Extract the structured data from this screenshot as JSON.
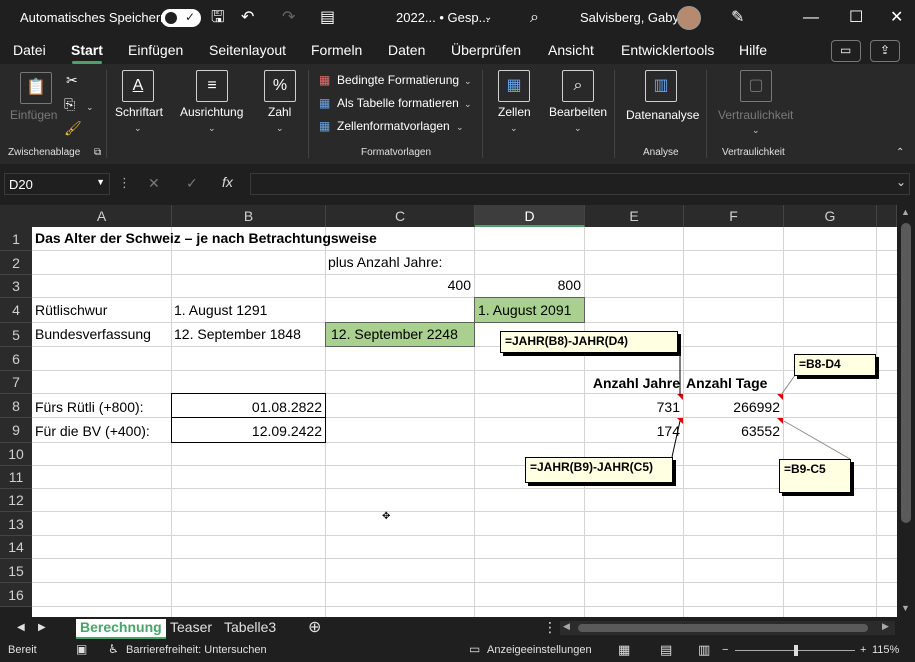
{
  "titlebar": {
    "autosave_label": "Automatisches Speichern",
    "doc_title": "2022... • Gesp...",
    "user_name": "Salvisberg, Gaby"
  },
  "menu": {
    "tabs": [
      "Datei",
      "Start",
      "Einfügen",
      "Seitenlayout",
      "Formeln",
      "Daten",
      "Überprüfen",
      "Ansicht",
      "Entwicklertools",
      "Hilfe"
    ],
    "active": "Start"
  },
  "ribbon": {
    "einfuegen": "Einfügen",
    "zwischenablage": "Zwischenablage",
    "schriftart": "Schriftart",
    "ausrichtung": "Ausrichtung",
    "zahl": "Zahl",
    "bedingte": "Bedingte Formatierung",
    "als_tabelle": "Als Tabelle formatieren",
    "zellenformat": "Zellenformatvorlagen",
    "formatvorlagen": "Formatvorlagen",
    "zellen": "Zellen",
    "bearbeiten": "Bearbeiten",
    "datenanalyse": "Datenanalyse",
    "analyse": "Analyse",
    "vertraulichkeit_btn": "Vertraulichkeit",
    "vertraulichkeit_group": "Vertraulichkeit"
  },
  "formula_bar": {
    "name_box": "D20",
    "fx": "fx",
    "formula": ""
  },
  "columns": [
    "A",
    "B",
    "C",
    "D",
    "E",
    "F",
    "G"
  ],
  "rows": [
    "1",
    "2",
    "3",
    "4",
    "5",
    "6",
    "7",
    "8",
    "9",
    "10",
    "11",
    "12",
    "13",
    "14",
    "15",
    "16"
  ],
  "cells": {
    "a1": "Das Alter der Schweiz – je nach Betrachtungsweise",
    "c2": "plus Anzahl Jahre:",
    "c3": "400",
    "d3": "800",
    "a4": "Rütlischwur",
    "b4": "1. August 1291",
    "d4": "1. August 2091",
    "a5": "Bundesverfassung",
    "b5": "12. September 1848",
    "c5": "12. September 2248",
    "e7": "Anzahl Jahre",
    "f7": "Anzahl Tage",
    "a8": "Fürs Rütli (+800):",
    "b8": "01.08.2822",
    "e8": "731",
    "f8": "266992",
    "a9": "Für die BV (+400):",
    "b9": "12.09.2422",
    "e9": "174",
    "f9": "63552"
  },
  "notes": {
    "e8_note": "=JAHR(B8)-JAHR(D4)",
    "f8_note": "=B8-D4",
    "e9_note": "=JAHR(B9)-JAHR(C5)",
    "f9_note": "=B9-C5"
  },
  "sheet_tabs": [
    "Berechnung",
    "Teaser",
    "Tabelle3"
  ],
  "active_sheet": "Berechnung",
  "status": {
    "ready": "Bereit",
    "accessibility": "Barrierefreiheit: Untersuchen",
    "display_settings": "Anzeigeeinstellungen",
    "zoom": "115%"
  }
}
